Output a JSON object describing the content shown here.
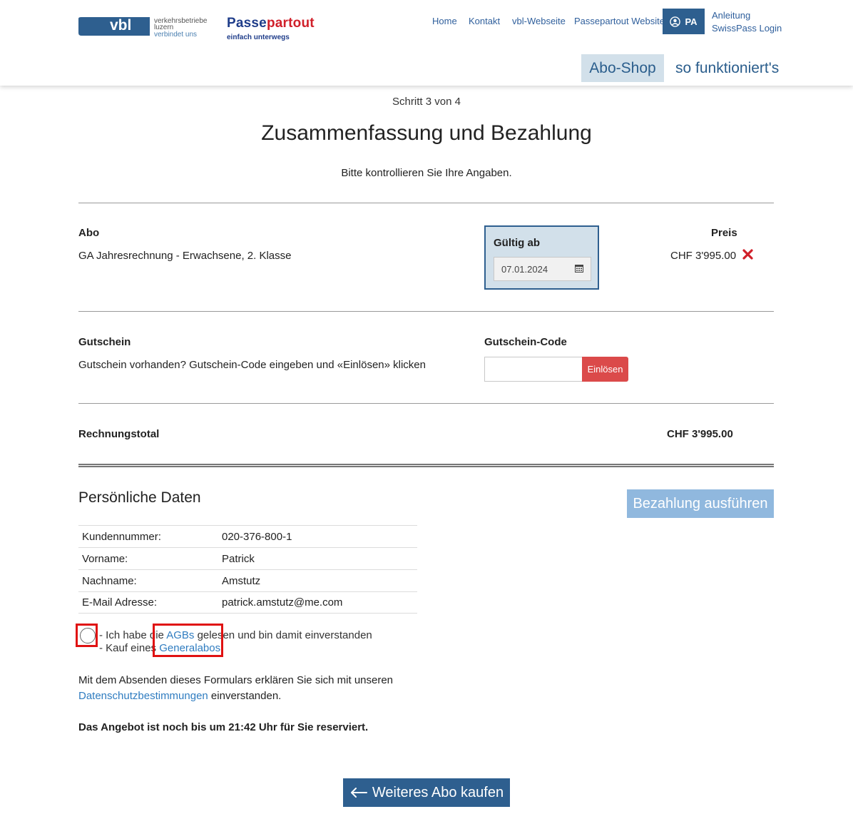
{
  "header": {
    "vbl_logo_text": "vbl",
    "vbl_lines": [
      "verkehrsbetriebe",
      "luzern",
      "verbindet uns"
    ],
    "pp_part1": "Passe",
    "pp_part2": "partout",
    "pp_tagline": "einfach unterwegs",
    "nav": [
      "Home",
      "Kontakt",
      "vbl-Webseite",
      "Passepartout Website"
    ],
    "user_initials": "PA",
    "sublinks": [
      "Anleitung",
      "SwissPass Login"
    ],
    "tabs": [
      "Abo-Shop",
      "so funktioniert's"
    ]
  },
  "intro": {
    "step": "Schritt 3 von 4",
    "title": "Zusammenfassung und Bezahlung",
    "subtitle": "Bitte kontrollieren Sie Ihre Angaben."
  },
  "abo": {
    "label": "Abo",
    "description": "GA Jahresrechnung - Erwachsene, 2. Klasse",
    "valid_label": "Gültig ab",
    "valid_date": "07.01.2024",
    "price_label": "Preis",
    "price": "CHF 3'995.00"
  },
  "voucher": {
    "label": "Gutschein",
    "hint": "Gutschein vorhanden? Gutschein-Code eingeben und «Einlösen» klicken",
    "code_label": "Gutschein-Code",
    "code_value": "",
    "redeem": "Einlösen"
  },
  "total": {
    "label": "Rechnungstotal",
    "value": "CHF 3'995.00"
  },
  "personal": {
    "title": "Persönliche Daten",
    "pay_button": "Bezahlung ausführen",
    "rows": [
      {
        "key": "Kundennummer:",
        "value": "020-376-800-1"
      },
      {
        "key": "Vorname:",
        "value": "Patrick"
      },
      {
        "key": "Nachname:",
        "value": "Amstutz"
      },
      {
        "key": "E-Mail Adresse:",
        "value": "patrick.amstutz@me.com"
      }
    ]
  },
  "consent": {
    "line1_pre": "- Ich habe die ",
    "line1_link": "AGBs",
    "line1_post": " gelesen und bin damit einverstanden",
    "line2_pre": "- Kauf eines ",
    "line2_link": "Generalabos"
  },
  "privacy": {
    "line1": "Mit dem Absenden dieses Formulars erklären Sie sich mit unseren",
    "link": "Datenschutzbestimmungen",
    "line2_post": " einverstanden."
  },
  "reserve_text": "Das Angebot ist noch bis um 21:42 Uhr für Sie reserviert.",
  "more_button": "Weiteres Abo kaufen",
  "colors": {
    "primary": "#2e5f8f",
    "tab_bg": "#d2e0ea",
    "danger": "#db4a4a",
    "link": "#2f7cc0",
    "pay_disabled": "#90b8de",
    "highlight": "#e01212"
  }
}
